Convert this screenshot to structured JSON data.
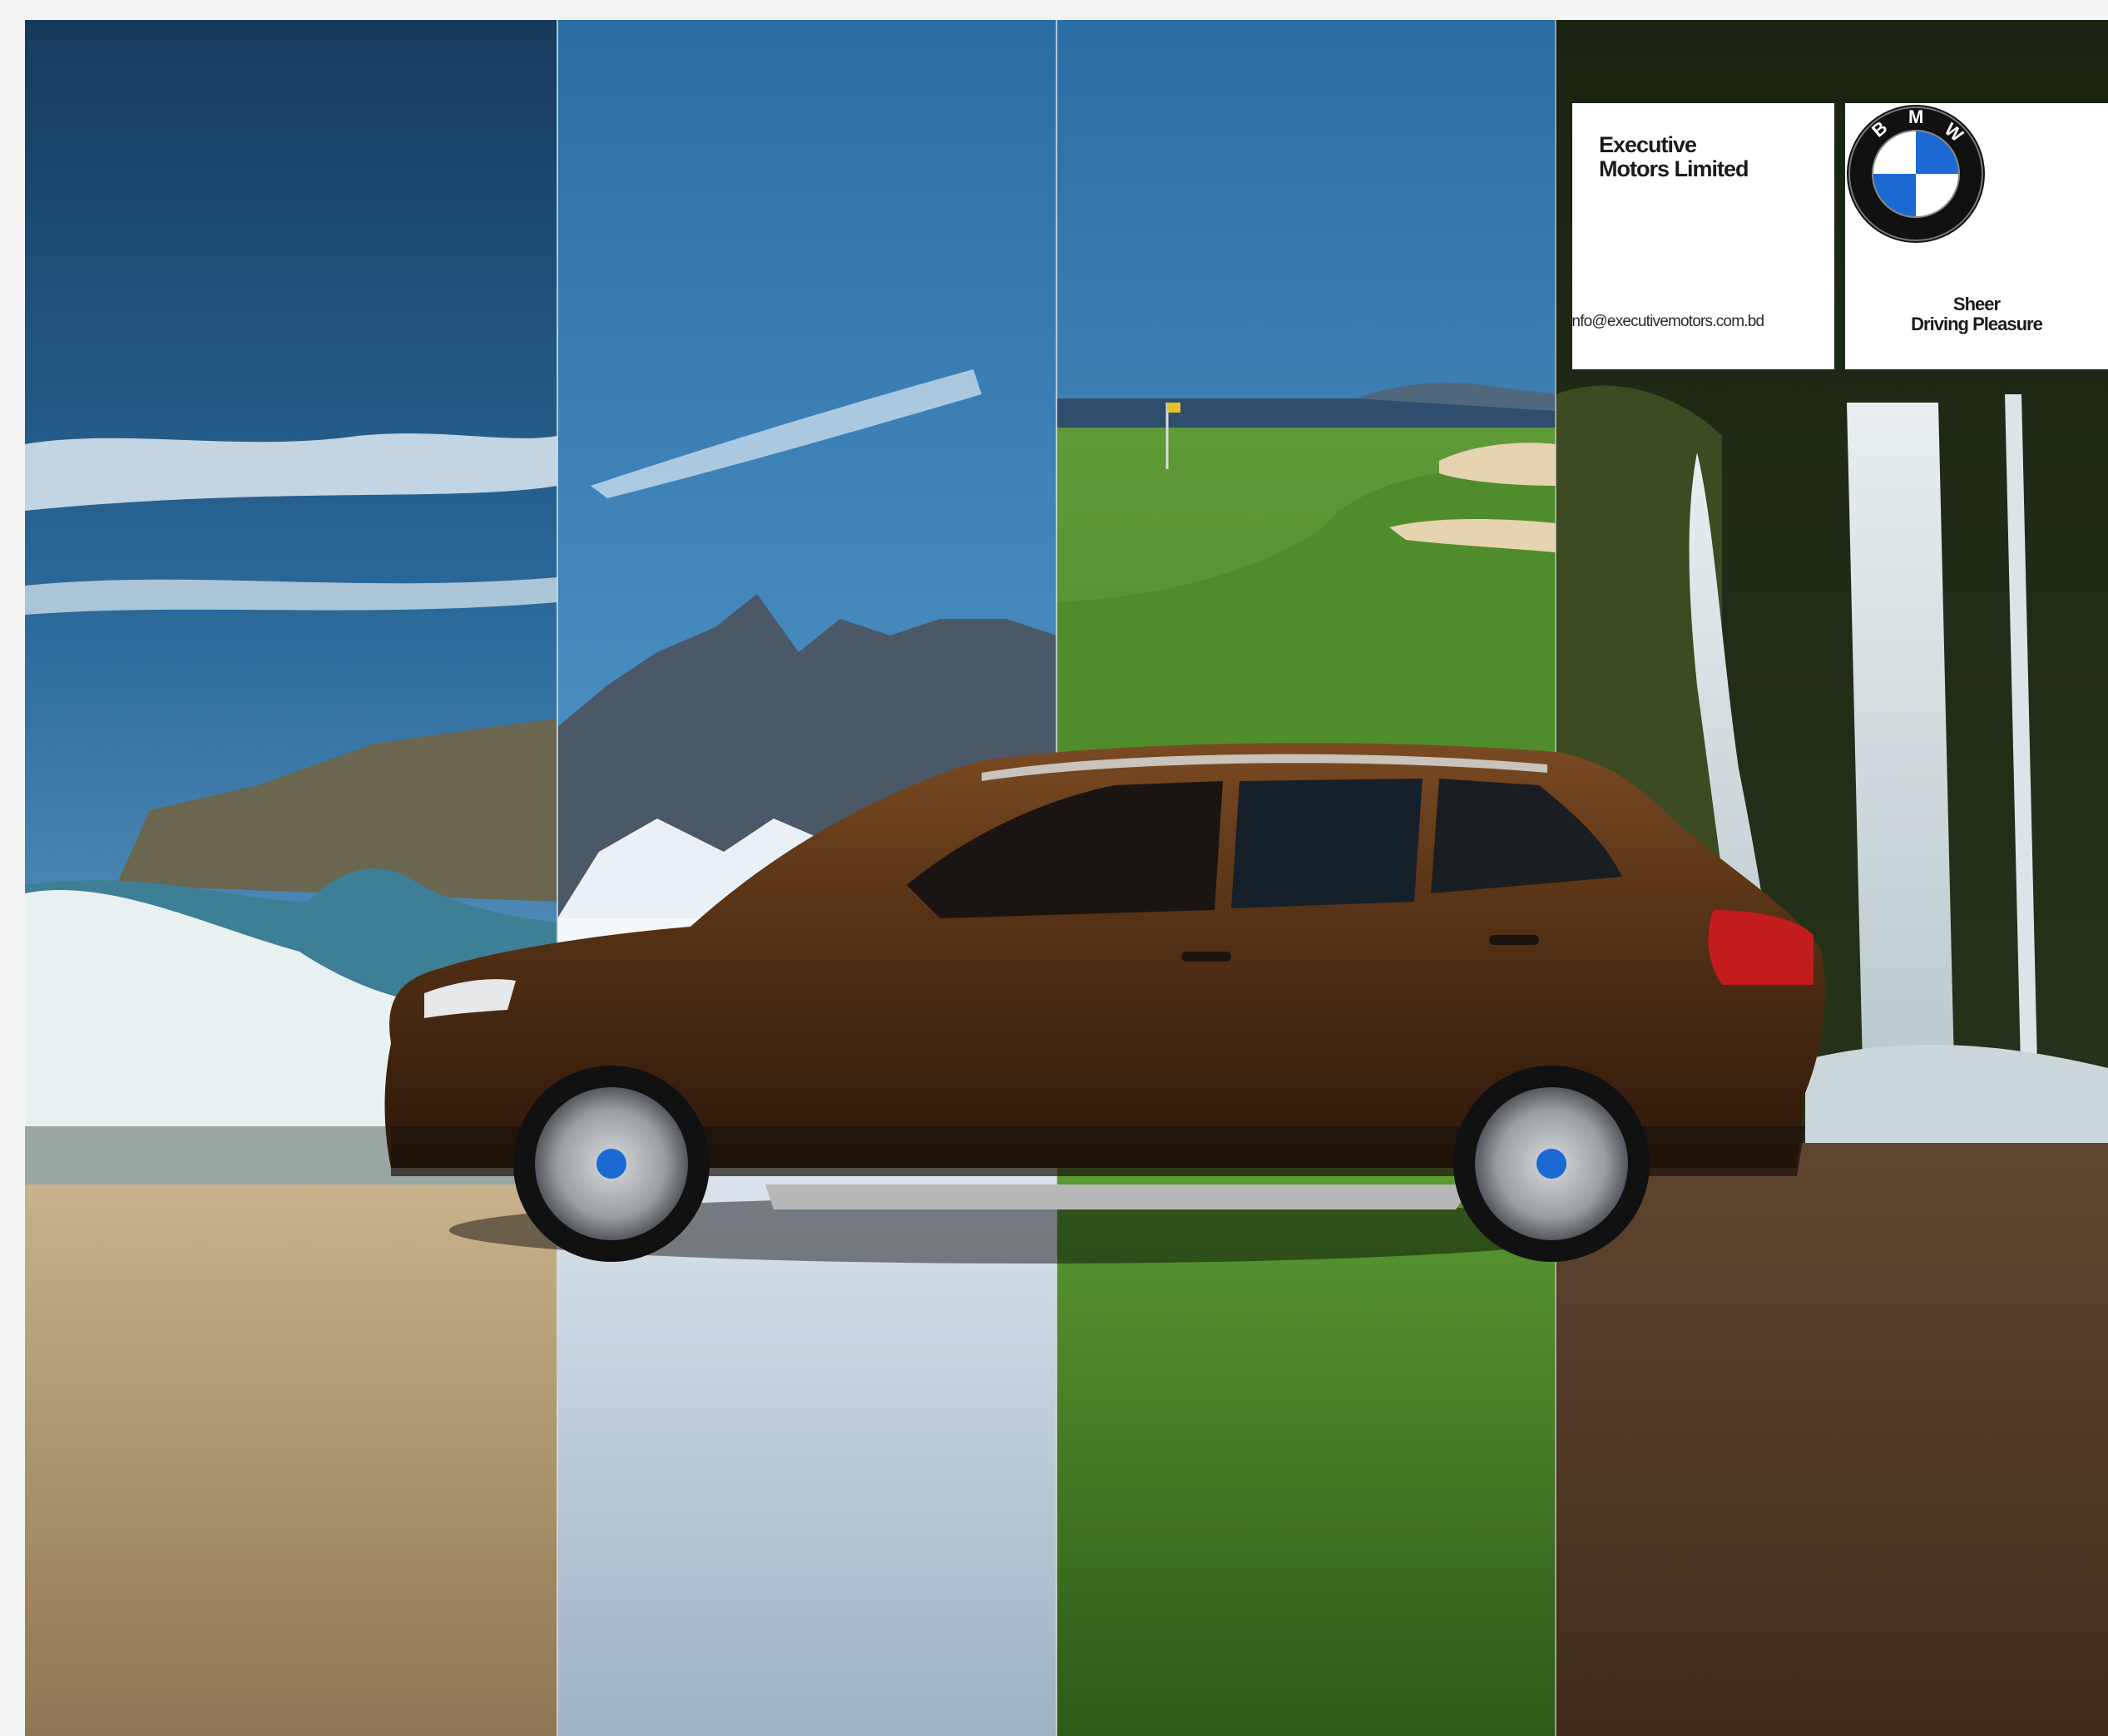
{
  "company": {
    "name_line1": "Executive",
    "name_line2": "Motors Limited",
    "email": "info@executivemotors.com.bd"
  },
  "brand": {
    "logo_letters": [
      "B",
      "M",
      "W"
    ],
    "tagline_line1": "Sheer",
    "tagline_line2": "Driving Pleasure"
  },
  "scenes": [
    "beach",
    "snow-mountain",
    "golf-course",
    "waterfall"
  ],
  "colors": {
    "car_body": "#5a3416",
    "sky_blue": "#3a7eb8",
    "grass": "#3f7a22",
    "sand": "#b8a07a",
    "snow": "#e6eef4",
    "dirt": "#6e5338",
    "bmw_blue": "#1c69d4"
  }
}
